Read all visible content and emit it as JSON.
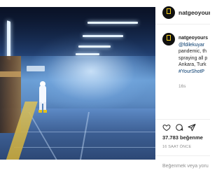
{
  "post": {
    "username": "natgeoyours",
    "caption": {
      "username": "natgeoyours",
      "lines": [
        "@fdilekuyar",
        "pandemic, th",
        "spraying all p",
        "Ankara, Turk",
        "#YourShotP"
      ],
      "age": "16s"
    },
    "likes": "37.783 beğenme",
    "posted_ago": "16 SAAT ÖNCE",
    "comment_placeholder": "Beğenmek veya yorum"
  },
  "icons": {
    "like": "heart-icon",
    "comment": "comment-icon",
    "share": "share-icon",
    "avatar_logo": "natgeo-frame-logo"
  },
  "colors": {
    "brand_yellow": "#f6cf1e",
    "text": "#262626",
    "muted": "#8e8e8e",
    "link": "#00376b",
    "divider": "#efefef"
  }
}
